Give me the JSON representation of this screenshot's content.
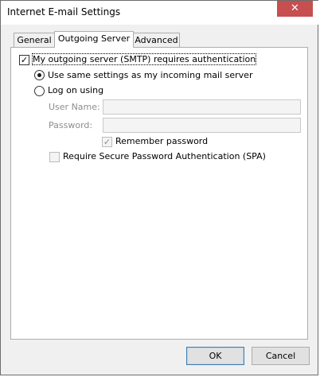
{
  "window": {
    "title": "Internet E-mail Settings",
    "close_glyph": "✕"
  },
  "tabs": [
    {
      "label": "General",
      "active": false
    },
    {
      "label": "Outgoing Server",
      "active": true
    },
    {
      "label": "Advanced",
      "active": false
    }
  ],
  "outgoing": {
    "requires_auth": {
      "label": "My outgoing server (SMTP) requires authentication",
      "checked": true
    },
    "use_same": {
      "label": "Use same settings as my incoming mail server",
      "selected": true
    },
    "log_on_using": {
      "label": "Log on using",
      "selected": false
    },
    "user_name": {
      "label": "User Name:",
      "value": ""
    },
    "password": {
      "label": "Password:",
      "value": ""
    },
    "remember_password": {
      "label": "Remember password",
      "checked": true,
      "enabled": false
    },
    "require_spa": {
      "label": "Require Secure Password Authentication (SPA)",
      "checked": false,
      "enabled": false
    }
  },
  "buttons": {
    "ok": "OK",
    "cancel": "Cancel"
  },
  "check_glyph": "✓"
}
